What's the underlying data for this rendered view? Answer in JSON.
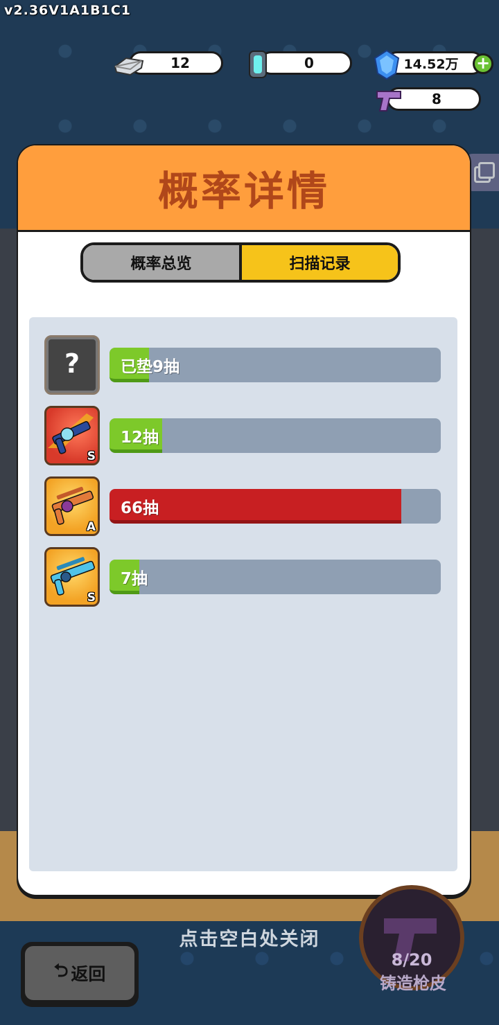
{
  "version": "v2.36V1A1B1C1",
  "resources": {
    "silver": "12",
    "capsule": "0",
    "diamond": "14.52万",
    "gun_ticket": "8"
  },
  "panel": {
    "title": "概率详情",
    "tabs": [
      "概率总览",
      "扫描记录"
    ],
    "active_tab": 1
  },
  "records": [
    {
      "icon": "mystery-item-icon",
      "rank": "",
      "label": "已垫9抽",
      "fill_fraction": 0.12,
      "bar_color": "green"
    },
    {
      "icon": "rifle-red-icon",
      "rank": "S",
      "label": "12抽",
      "fill_fraction": 0.16,
      "bar_color": "green"
    },
    {
      "icon": "rifle-orange-icon",
      "rank": "A",
      "label": "66抽",
      "fill_fraction": 0.88,
      "bar_color": "red"
    },
    {
      "icon": "rifle-blue-icon",
      "rank": "S",
      "label": "7抽",
      "fill_fraction": 0.09,
      "bar_color": "green"
    }
  ],
  "footer": {
    "hint": "点击空白处关闭",
    "back_label": "返回",
    "forge_count": "8/20",
    "forge_label": "铸造枪皮"
  },
  "colors": {
    "header_orange": "#ff9e3d",
    "title_brown": "#b0471a",
    "tab_active": "#f6c31a",
    "bar_green": "#7dc92a",
    "bar_red": "#c81f22"
  }
}
